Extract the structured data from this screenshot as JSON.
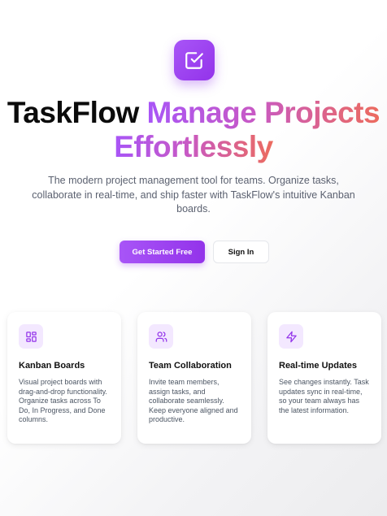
{
  "hero": {
    "brand": "TaskFlow",
    "title_gradient_line1": "Manage Projects",
    "title_gradient_line2": "Effortlessly",
    "subtitle": "The modern project management tool for teams. Organize tasks, collaborate in real-time, and ship faster with TaskFlow's intuitive Kanban boards.",
    "logo_icon": "square-check-icon"
  },
  "actions": {
    "primary_label": "Get Started Free",
    "secondary_label": "Sign In"
  },
  "features": [
    {
      "icon": "layout-grid-icon",
      "title": "Kanban Boards",
      "description": "Visual project boards with drag-and-drop functionality. Organize tasks across To Do, In Progress, and Done columns."
    },
    {
      "icon": "users-icon",
      "title": "Team Collaboration",
      "description": "Invite team members, assign tasks, and collaborate seamlessly. Keep everyone aligned and productive."
    },
    {
      "icon": "zap-icon",
      "title": "Real-time Updates",
      "description": "See changes instantly. Task updates sync in real-time, so your team always has the latest information."
    }
  ],
  "colors": {
    "accent": "#9333ea",
    "accent_light": "#a855f7",
    "gradient_end": "#ec6b5e",
    "icon_bg": "#f3e8ff"
  }
}
